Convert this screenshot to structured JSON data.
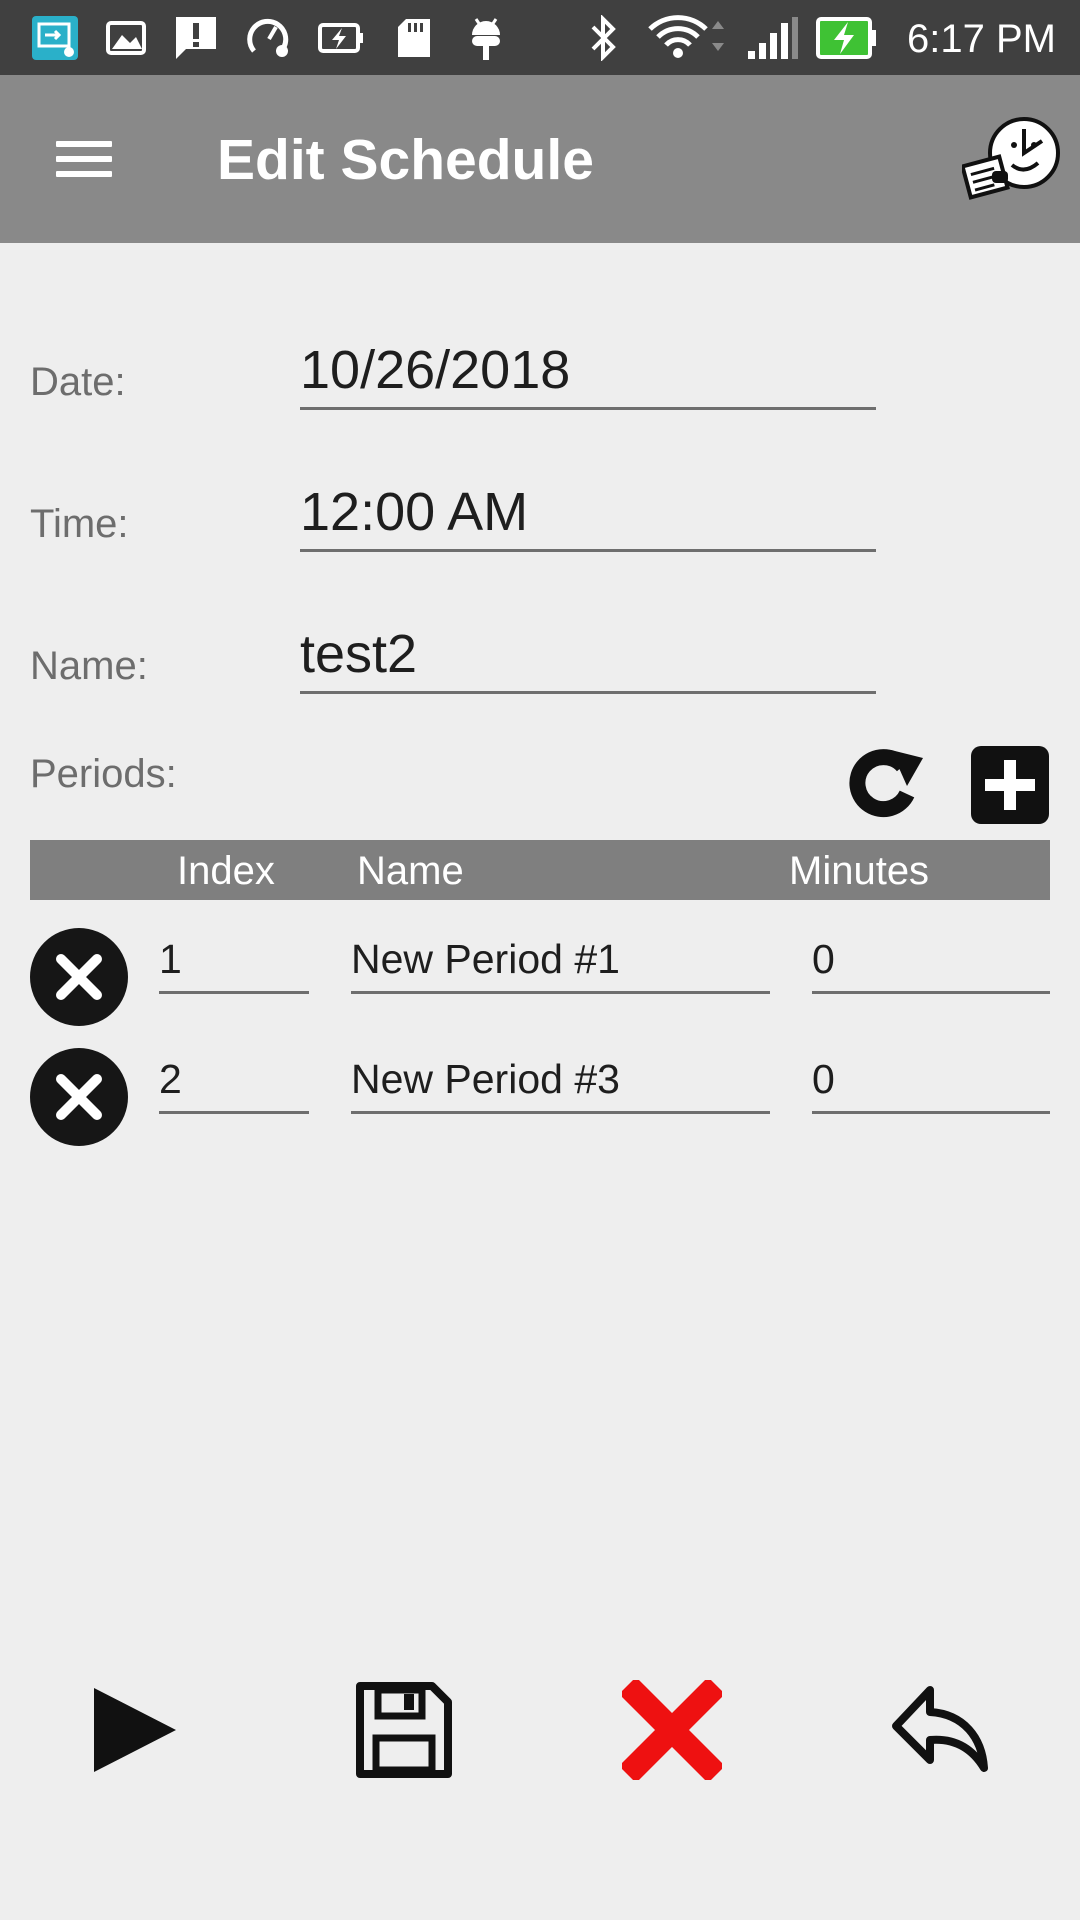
{
  "status_bar": {
    "time": "6:17 PM",
    "icons": [
      "screen-cast-icon",
      "image-icon",
      "alert-message-icon",
      "speed-settings-icon",
      "battery-saver-icon",
      "sd-card-icon",
      "android-debug-icon",
      "bluetooth-icon",
      "wifi-icon",
      "signal-icon",
      "battery-charging-icon"
    ]
  },
  "app_bar": {
    "title": "Edit Schedule",
    "menu_icon": "hamburger-menu-icon",
    "logo_icon": "clock-mascot-logo"
  },
  "form": {
    "date": {
      "label": "Date:",
      "value": "10/26/2018"
    },
    "time": {
      "label": "Time:",
      "value": "12:00 AM"
    },
    "name": {
      "label": "Name:",
      "value": "test2"
    }
  },
  "periods": {
    "label": "Periods:",
    "refresh_icon": "refresh-icon",
    "add_icon": "add-icon",
    "columns": {
      "index": "Index",
      "name": "Name",
      "minutes": "Minutes"
    },
    "rows": [
      {
        "index": "1",
        "name": "New Period #1",
        "minutes": "0"
      },
      {
        "index": "2",
        "name": "New Period #3",
        "minutes": "0"
      }
    ]
  },
  "actions": {
    "play_icon": "play-icon",
    "save_icon": "save-icon",
    "delete_icon": "delete-x-icon",
    "back_icon": "reply-back-icon"
  },
  "colors": {
    "status_bar": "#404040",
    "app_bar": "#898989",
    "background": "#eeeeee",
    "table_header": "#7f7f7f",
    "delete_red": "#ee1111",
    "battery_green": "#3fc234"
  }
}
